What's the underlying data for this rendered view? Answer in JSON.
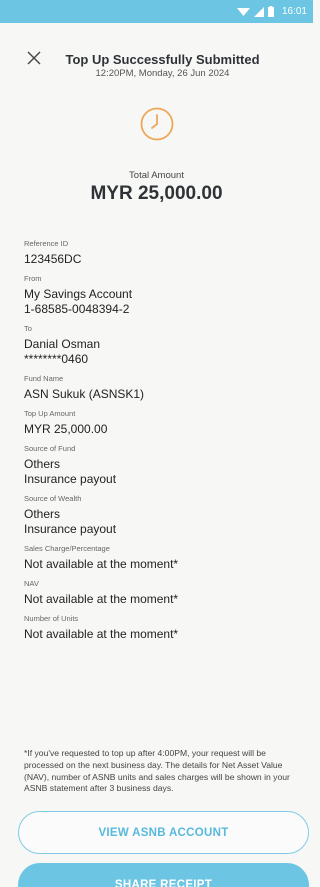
{
  "status_bar": {
    "time": "16:01"
  },
  "header": {
    "title": "Top Up Successfully Submitted",
    "subtitle": "12:20PM, Monday, 26 Jun 2024"
  },
  "summary": {
    "total_label": "Total Amount",
    "total_value": "MYR 25,000.00"
  },
  "details": [
    {
      "label": "Reference ID",
      "lines": [
        "123456DC"
      ]
    },
    {
      "label": "From",
      "lines": [
        "My Savings Account",
        "1-68585-0048394-2"
      ]
    },
    {
      "label": "To",
      "lines": [
        "Danial Osman",
        "********0460"
      ]
    },
    {
      "label": "Fund Name",
      "lines": [
        "ASN Sukuk (ASNSK1)"
      ]
    },
    {
      "label": "Top Up Amount",
      "lines": [
        "MYR 25,000.00"
      ]
    },
    {
      "label": "Source of Fund",
      "lines": [
        "Others",
        "Insurance payout"
      ]
    },
    {
      "label": "Source of Wealth",
      "lines": [
        "Others",
        "Insurance payout"
      ]
    },
    {
      "label": "Sales Charge/Percentage",
      "lines": [
        "Not available at the moment*"
      ]
    },
    {
      "label": "NAV",
      "lines": [
        "Not available at the moment*"
      ]
    },
    {
      "label": "Number of Units",
      "lines": [
        "Not available at the moment*"
      ]
    }
  ],
  "disclaimer": "*If you've requested to top up after 4:00PM, your request will be processed on the next business day. The details for Net Asset Value (NAV), number of ASNB units and sales charges will be shown in your ASNB statement after 3 business days.",
  "buttons": {
    "view_account": "VIEW ASNB ACCOUNT",
    "share_receipt": "SHARE RECEIPT"
  },
  "icons": {
    "close": "close-icon",
    "status": "clock-icon",
    "wifi": "wifi-icon",
    "signal": "signal-icon",
    "battery": "battery-icon"
  },
  "colors": {
    "accent": "#6cc6e3",
    "clock": "#f0a65a",
    "background": "#f7f8f6"
  }
}
